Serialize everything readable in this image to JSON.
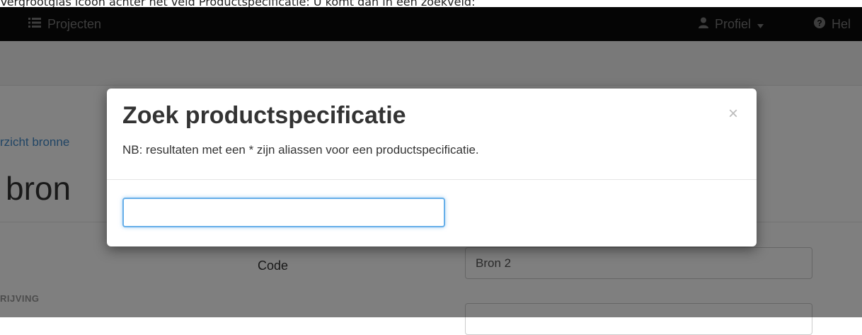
{
  "caption": "Vergrootglas icoon achter het veld Productspecificatie: U komt dan in een zoekveld:",
  "navbar": {
    "projects_label": "Projecten",
    "profile_label": "Profiel",
    "help_label": "Hel",
    "icons": [
      "list-icon",
      "user-icon",
      "caret-down-icon",
      "question-icon"
    ]
  },
  "page": {
    "breadcrumb_link": "rzicht bronne",
    "title": "bron",
    "code_label": "Code",
    "code_value": "Bron 2",
    "section_label": "RIJVING"
  },
  "modal": {
    "title": "Zoek productspecificatie",
    "note": "NB: resultaten met een * zijn aliassen voor een productspecificatie.",
    "close_symbol": "×",
    "search_value": ""
  },
  "colors": {
    "navbar_bg": "#0b0b0b",
    "link": "#428bca",
    "input_focus": "#66afe9"
  }
}
